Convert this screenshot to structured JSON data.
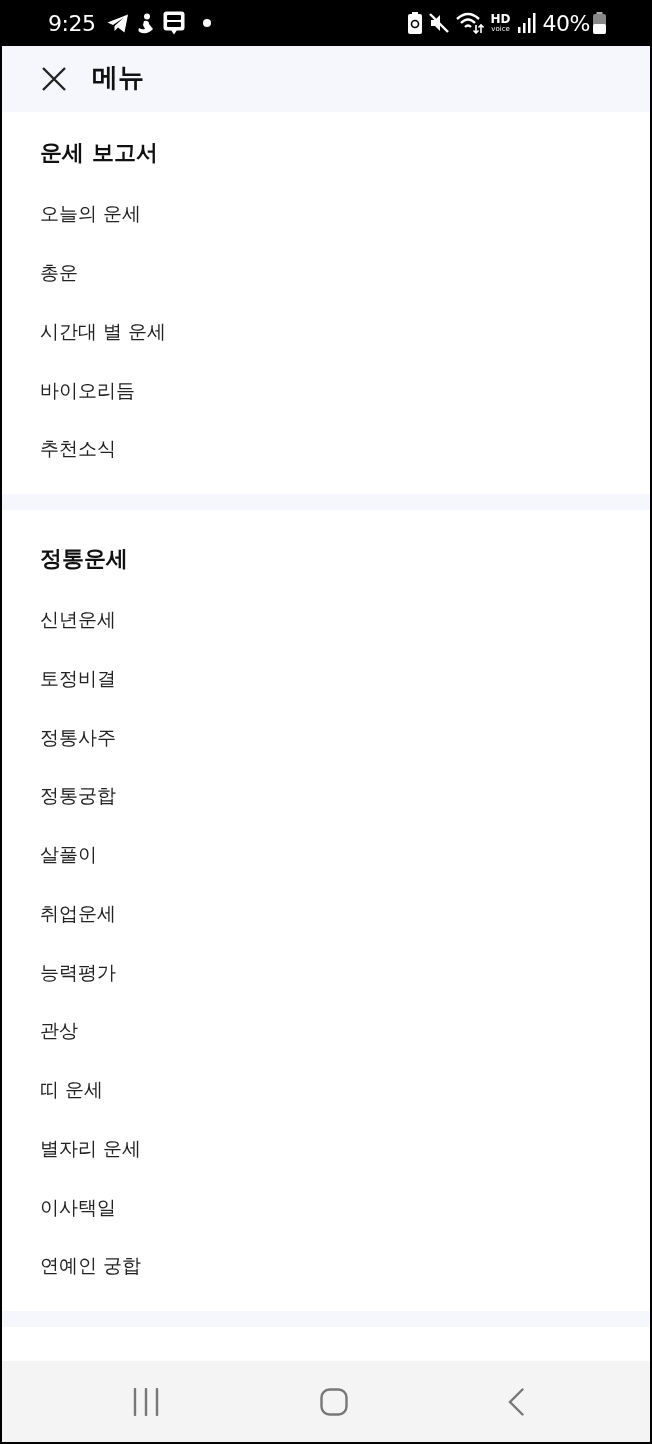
{
  "status_bar": {
    "time": "9:25",
    "hd_label": "HD",
    "voice_label": "voice",
    "battery": "40%"
  },
  "header": {
    "title": "메뉴"
  },
  "sections": [
    {
      "title": "운세 보고서",
      "items": [
        "오늘의 운세",
        "총운",
        "시간대 별 운세",
        "바이오리듬",
        "추천소식"
      ]
    },
    {
      "title": "정통운세",
      "items": [
        "신년운세",
        "토정비결",
        "정통사주",
        "정통궁합",
        "살풀이",
        "취업운세",
        "능력평가",
        "관상",
        "띠 운세",
        "별자리 운세",
        "이사택일",
        "연예인 궁합"
      ]
    }
  ]
}
